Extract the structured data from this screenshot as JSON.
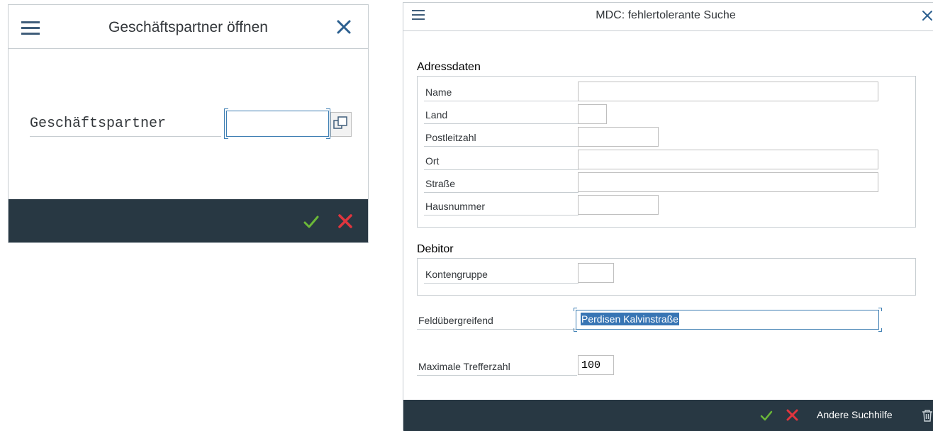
{
  "colors": {
    "accent": "#3f7fb3",
    "footer_bg": "#283843",
    "ok_green": "#6bb838",
    "cancel_red": "#e0353e",
    "selection_bg": "#3875b4"
  },
  "left_dialog": {
    "title": "Geschäftspartner öffnen",
    "field_label": "Geschäftspartner",
    "field_value": "",
    "icons": [
      "menu-icon",
      "close-icon",
      "value-help-icon",
      "ok-icon",
      "cancel-icon"
    ]
  },
  "right_dialog": {
    "title": "MDC: fehlertolerante Suche",
    "address_group": {
      "title": "Adressdaten",
      "fields": [
        {
          "label": "Name",
          "value": ""
        },
        {
          "label": "Land",
          "value": ""
        },
        {
          "label": "Postleitzahl",
          "value": ""
        },
        {
          "label": "Ort",
          "value": ""
        },
        {
          "label": "Straße",
          "value": ""
        },
        {
          "label": "Hausnummer",
          "value": ""
        }
      ]
    },
    "debitor_group": {
      "title": "Debitor",
      "fields": [
        {
          "label": "Kontengruppe",
          "value": ""
        }
      ]
    },
    "cross_field": {
      "label": "Feldübergreifend",
      "value": "Perdisen Kalvinstraße"
    },
    "max_hits": {
      "label": "Maximale Trefferzahl",
      "value": "100"
    },
    "footer": {
      "alt_search_label": "Andere Suchhilfe"
    },
    "icons": [
      "menu-icon",
      "close-icon",
      "ok-icon",
      "cancel-icon",
      "trash-icon"
    ]
  }
}
